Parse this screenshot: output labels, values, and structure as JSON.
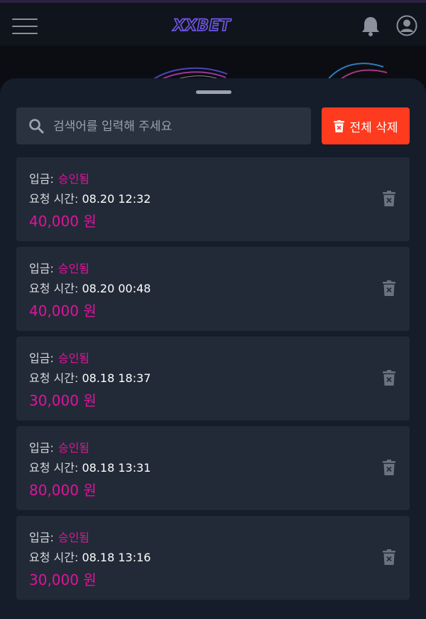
{
  "header": {
    "logo_text": "XXBET"
  },
  "search": {
    "placeholder": "검색어를 입력해 주세요"
  },
  "delete_all_label": "전체 삭제",
  "items": [
    {
      "type_label": "입금:",
      "status": "승인됨",
      "time_label": "요청 시간:",
      "time": "08.20 12:32",
      "amount": "40,000 원"
    },
    {
      "type_label": "입금:",
      "status": "승인됨",
      "time_label": "요청 시간:",
      "time": "08.20 00:48",
      "amount": "40,000 원"
    },
    {
      "type_label": "입금:",
      "status": "승인됨",
      "time_label": "요청 시간:",
      "time": "08.18 18:37",
      "amount": "30,000 원"
    },
    {
      "type_label": "입금:",
      "status": "승인됨",
      "time_label": "요청 시간:",
      "time": "08.18 13:31",
      "amount": "80,000 원"
    },
    {
      "type_label": "입금:",
      "status": "승인됨",
      "time_label": "요청 시간:",
      "time": "08.18 13:16",
      "amount": "30,000 원"
    }
  ],
  "colors": {
    "accent": "#e0139c",
    "danger": "#ff3b1f",
    "panel": "#151c2a",
    "card": "#222a37"
  }
}
